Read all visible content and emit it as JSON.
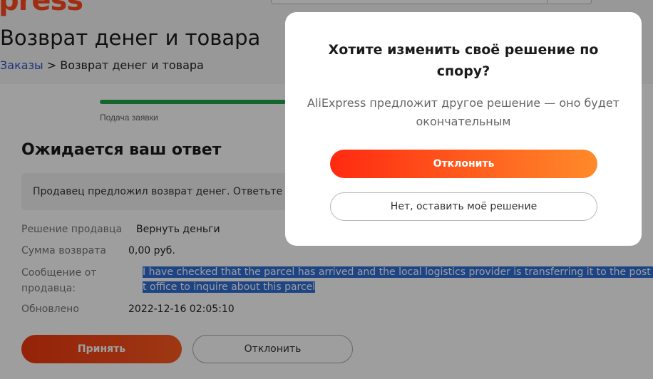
{
  "header": {
    "logo_text": "press",
    "brand_color": "#ff4a1c"
  },
  "page": {
    "title": "Возврат денег и товара",
    "breadcrumb": {
      "link": "Заказы",
      "separator": ">",
      "current": "Возврат денег и товара"
    }
  },
  "progress": {
    "step_label": "Подача заявки",
    "fill_fraction": 0.87,
    "color": "#21a548"
  },
  "status": {
    "title": "Ожидается ваш ответ",
    "notice": "Продавец предложил возврат денег. Ответьте до"
  },
  "details": {
    "seller_decision_label": "Решение продавца",
    "seller_decision_value": "Вернуть деньги",
    "refund_amount_label": "Сумма возврата",
    "refund_amount_value": "0,00 руб.",
    "seller_message_label_line1": "Сообщение от",
    "seller_message_label_line2": "продавца:",
    "seller_message_line1": "I have checked that the parcel has arrived and the local logistics provider is transferring it to the post o",
    "seller_message_line2": "t office to inquire about this parcel",
    "updated_label": "Обновлено",
    "updated_value": "2022-12-16 02:05:10"
  },
  "actions": {
    "accept_label": "Принять",
    "decline_label": "Отклонить"
  },
  "modal": {
    "title": "Хотите изменить своё решение по спору?",
    "description": "AliExpress предложит другое решение — оно будет окончательным",
    "confirm_label": "Отклонить",
    "cancel_label": "Нет, оставить моё решение"
  }
}
